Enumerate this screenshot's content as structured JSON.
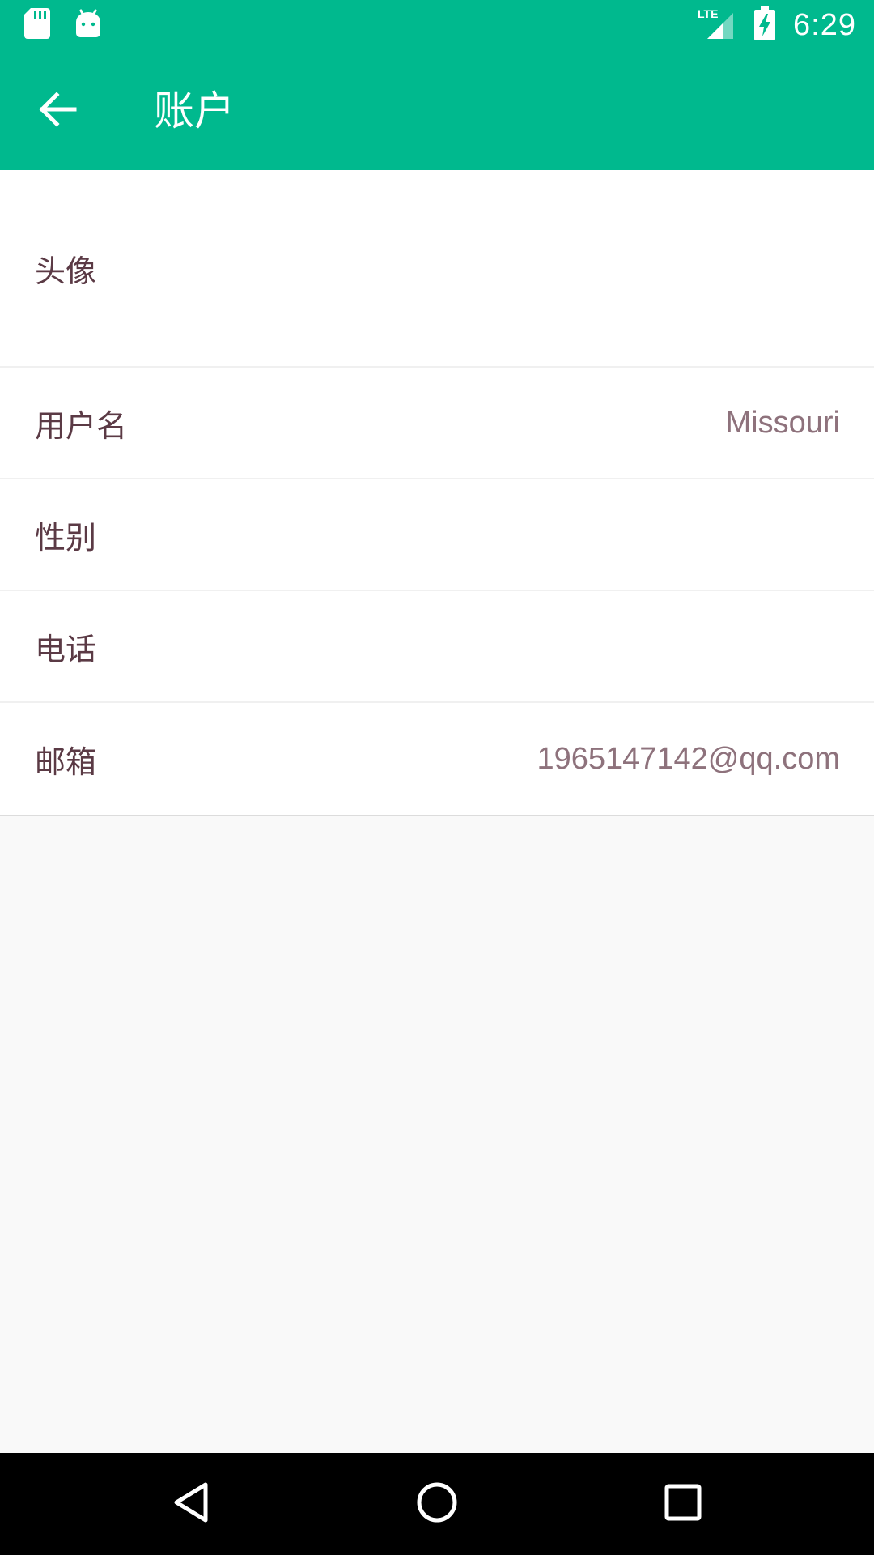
{
  "status_bar": {
    "time": "6:29",
    "network": "LTE",
    "icons": [
      "sd-card-icon",
      "android-icon",
      "lte-signal-icon",
      "battery-charging-icon"
    ]
  },
  "toolbar": {
    "title": "账户",
    "back_icon": "arrow-left-icon"
  },
  "form": {
    "rows": [
      {
        "label": "头像",
        "value": ""
      },
      {
        "label": "用户名",
        "value": "Missouri"
      },
      {
        "label": "性别",
        "value": ""
      },
      {
        "label": "电话",
        "value": ""
      },
      {
        "label": "邮箱",
        "value": "1965147142@qq.com"
      }
    ]
  },
  "colors": {
    "primary": "#00b98e",
    "label_text": "#5b3a45",
    "value_text": "#8e727c",
    "background": "#f9f9f9"
  },
  "nav_bar": {
    "icons": [
      "nav-back-icon",
      "nav-home-icon",
      "nav-recents-icon"
    ]
  }
}
